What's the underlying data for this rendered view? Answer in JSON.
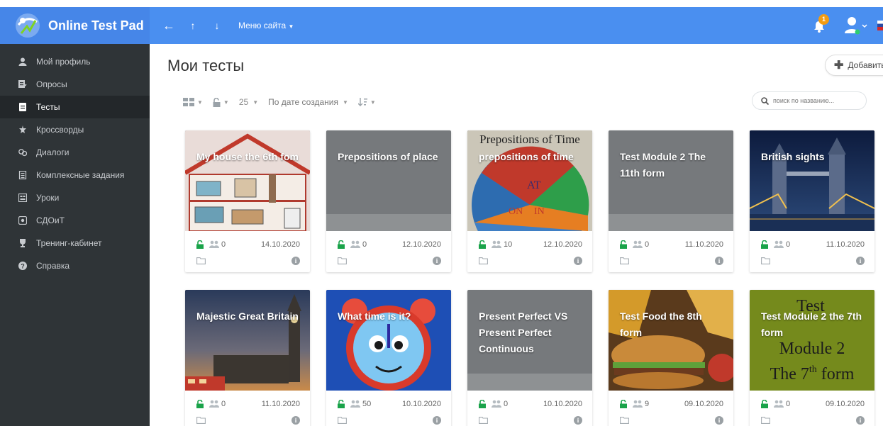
{
  "app": {
    "name": "Online Test Pad"
  },
  "topnav": {
    "menu_label": "Меню сайта",
    "notification_count": "1"
  },
  "sidebar": {
    "items": [
      {
        "label": "Мой профиль",
        "icon": "user-icon"
      },
      {
        "label": "Опросы",
        "icon": "poll-icon"
      },
      {
        "label": "Тесты",
        "icon": "test-icon"
      },
      {
        "label": "Кроссворды",
        "icon": "crossword-icon"
      },
      {
        "label": "Диалоги",
        "icon": "dialog-icon"
      },
      {
        "label": "Комплексные задания",
        "icon": "complex-task-icon"
      },
      {
        "label": "Уроки",
        "icon": "lesson-icon"
      },
      {
        "label": "СДОиТ",
        "icon": "sdoit-icon"
      },
      {
        "label": "Тренинг-кабинет",
        "icon": "training-icon"
      },
      {
        "label": "Справка",
        "icon": "help-icon"
      }
    ],
    "active_index": 2
  },
  "main": {
    "title": "Мои тесты",
    "add_label": "Добавить",
    "toolbar": {
      "page_size": "25",
      "sort_label": "По дате создания"
    },
    "search_placeholder": "поиск по названию..."
  },
  "cards": [
    {
      "title": "My house the 6th fom",
      "participants": "0",
      "date": "14.10.2020",
      "cover": "house"
    },
    {
      "title": "Prepositions of place",
      "participants": "0",
      "date": "12.10.2020",
      "cover": "plain"
    },
    {
      "title": "prepositions of time",
      "participants": "10",
      "date": "12.10.2020",
      "cover": "clock-wheel"
    },
    {
      "title": "Test Module 2 The 11th form",
      "participants": "0",
      "date": "11.10.2020",
      "cover": "plain"
    },
    {
      "title": "British sights",
      "participants": "0",
      "date": "11.10.2020",
      "cover": "tower-bridge"
    },
    {
      "title": "Majestic Great Britain",
      "participants": "0",
      "date": "11.10.2020",
      "cover": "big-ben"
    },
    {
      "title": "What time is it?",
      "participants": "50",
      "date": "10.10.2020",
      "cover": "alarm-clock"
    },
    {
      "title": "Present Perfect VS Present Perfect Continuous",
      "participants": "0",
      "date": "10.10.2020",
      "cover": "plain"
    },
    {
      "title": "Test Food the 8th form",
      "participants": "9",
      "date": "09.10.2020",
      "cover": "burger"
    },
    {
      "title": "Test Module 2 the 7th form",
      "participants": "0",
      "date": "09.10.2020",
      "cover": "module-2"
    }
  ],
  "cover_text": {
    "prepositions_arc": "Prepositions of Time",
    "at": "AT",
    "on": "ON",
    "in": "IN",
    "module_test": "Test",
    "module_line1": "Module 2",
    "module_line2": "The 7",
    "module_sup": "th",
    "module_line3": " form"
  },
  "colors": {
    "topbar": "#4a8ff0",
    "sidebar": "#2f3437",
    "lock_green": "#1aa34a",
    "cover_gray": "#76797c"
  }
}
